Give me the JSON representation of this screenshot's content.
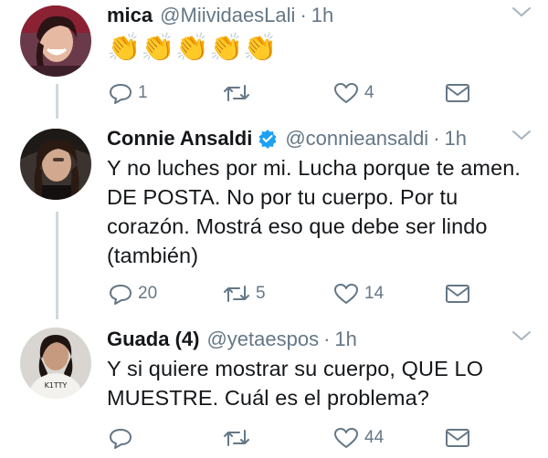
{
  "tweets": [
    {
      "name": "mica",
      "handle": "@MiividaesLali",
      "time": "1h",
      "verified": false,
      "emoji": "👏👏👏👏👏",
      "text": "",
      "replies": "1",
      "retweets": "",
      "likes": "4"
    },
    {
      "name": "Connie Ansaldi",
      "handle": "@connieansaldi",
      "time": "1h",
      "verified": true,
      "text": "Y no luches por mi. Lucha porque te amen. DE POSTA. No por tu cuerpo. Por tu corazón. Mostrá eso que debe ser lindo (también)",
      "replies": "20",
      "retweets": "5",
      "likes": "14"
    },
    {
      "name": "Guada (4)",
      "handle": "@yetaespos",
      "time": "1h",
      "verified": false,
      "text": "Y si quiere mostrar su cuerpo, QUE LO MUESTRE. Cuál es el problema?",
      "replies": "",
      "retweets": "",
      "likes": "44"
    }
  ],
  "separator": "·",
  "icons": {
    "reply": "reply-icon",
    "retweet": "retweet-icon",
    "like": "heart-icon",
    "message": "direct-message-icon",
    "more": "chevron-down-icon",
    "verified": "verified-badge-icon"
  },
  "colors": {
    "name": "#14171a",
    "muted": "#657786",
    "verified": "#1da1f2",
    "thread_line": "#cfd9de"
  }
}
